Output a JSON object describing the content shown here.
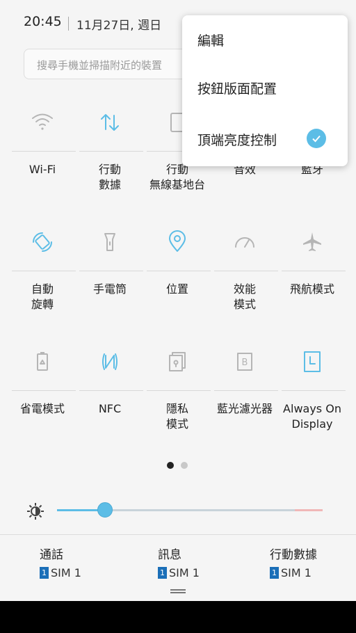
{
  "status": {
    "time": "20:45",
    "date": "11月27日, 週日"
  },
  "search": {
    "placeholder": "搜尋手機並掃描附近的裝置"
  },
  "tiles": [
    {
      "label": "Wi-Fi",
      "icon": "wifi-icon",
      "active": false
    },
    {
      "label": "行動\n數據",
      "icon": "mobile-data-icon",
      "active": true
    },
    {
      "label": "行動\n無線基地台",
      "icon": "hotspot-icon",
      "active": false
    },
    {
      "label": "音效",
      "icon": "sound-icon",
      "active": false
    },
    {
      "label": "藍牙",
      "icon": "bluetooth-icon",
      "active": false
    },
    {
      "label": "自動\n旋轉",
      "icon": "auto-rotate-icon",
      "active": true
    },
    {
      "label": "手電筒",
      "icon": "flashlight-icon",
      "active": false
    },
    {
      "label": "位置",
      "icon": "location-icon",
      "active": true
    },
    {
      "label": "效能\n模式",
      "icon": "performance-icon",
      "active": false
    },
    {
      "label": "飛航模式",
      "icon": "airplane-icon",
      "active": false
    },
    {
      "label": "省電模式",
      "icon": "power-saving-icon",
      "active": false
    },
    {
      "label": "NFC",
      "icon": "nfc-icon",
      "active": true
    },
    {
      "label": "隱私\n模式",
      "icon": "private-mode-icon",
      "active": false
    },
    {
      "label": "藍光濾光器",
      "icon": "blue-light-filter-icon",
      "active": false
    },
    {
      "label": "Always On\nDisplay",
      "icon": "always-on-display-icon",
      "active": true
    }
  ],
  "pager": {
    "count": 2,
    "current": 1
  },
  "brightness": {
    "level": 0.18
  },
  "sims": [
    {
      "title": "通話",
      "badge": "1",
      "sim": "SIM 1"
    },
    {
      "title": "訊息",
      "badge": "1",
      "sim": "SIM 1"
    },
    {
      "title": "行動數據",
      "badge": "1",
      "sim": "SIM 1"
    }
  ],
  "menu": {
    "edit": "編輯",
    "button_layout": "按鈕版面配置",
    "top_brightness": "頂端亮度控制",
    "top_brightness_checked": true
  },
  "colors": {
    "accent": "#5cbde6",
    "inactive": "#b5b5b5",
    "sim_badge": "#1b6fb8"
  }
}
